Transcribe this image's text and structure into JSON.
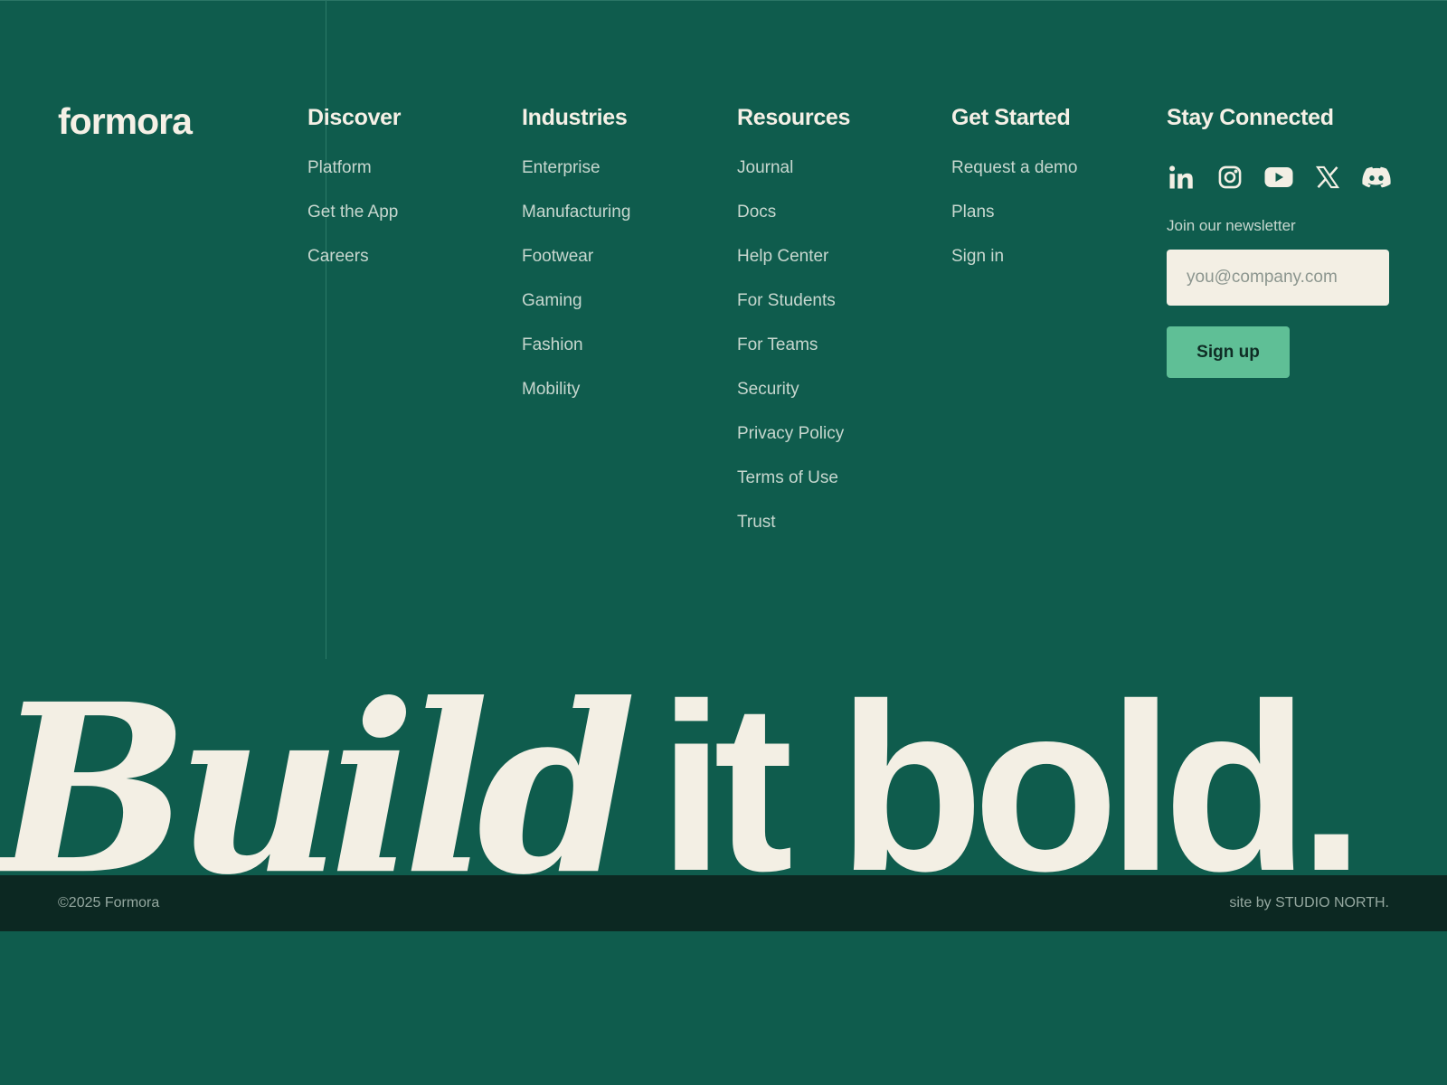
{
  "brand": {
    "logo_text": "formora"
  },
  "columns": [
    {
      "heading": "Discover",
      "links": [
        "Platform",
        "Get the App",
        "Careers"
      ]
    },
    {
      "heading": "Industries",
      "links": [
        "Enterprise",
        "Manufacturing",
        "Footwear",
        "Gaming",
        "Fashion",
        "Mobility"
      ]
    },
    {
      "heading": "Resources",
      "links": [
        "Journal",
        "Docs",
        "Help Center",
        "For Students",
        "For Teams",
        "Security",
        "Privacy Policy",
        "Terms of Use",
        "Trust"
      ]
    },
    {
      "heading": "Get Started",
      "links": [
        "Request a demo",
        "Plans",
        "Sign in"
      ]
    }
  ],
  "connect": {
    "heading": "Stay Connected",
    "social_icons": [
      "linkedin-icon",
      "instagram-icon",
      "youtube-icon",
      "x-icon",
      "discord-icon"
    ],
    "newsletter_label": "Join our newsletter",
    "email_placeholder": "you@company.com",
    "email_value": "",
    "signup_label": "Sign up"
  },
  "hero": {
    "word_italic": "Build",
    "word_bold": "it bold."
  },
  "footer": {
    "copyright": "©2025 Formora",
    "credit": "site by STUDIO NORTH."
  },
  "colors": {
    "background": "#0f5c4d",
    "cream": "#f3efe4",
    "accent": "#5fbf96",
    "bottom_bar": "#0c2822"
  }
}
